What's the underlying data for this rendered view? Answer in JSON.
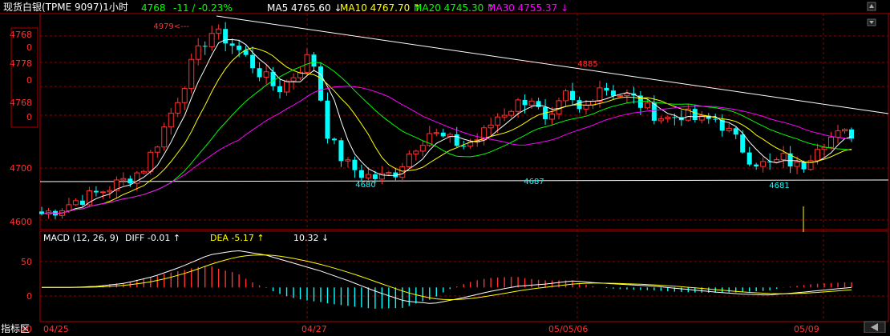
{
  "header": {
    "title": "现货白银(TPME  9097)1小时",
    "last": "4768",
    "change": "-11 / -0.23%",
    "ma": [
      {
        "label": "MA5 4765.60 ↓",
        "color": "#ffffff"
      },
      {
        "label": "MA10 4767.70 ↑",
        "color": "#ffff00"
      },
      {
        "label": "MA20 4745.30 ↑",
        "color": "#00ff00"
      },
      {
        "label": "MA30 4755.37 ↓",
        "color": "#ff00ff"
      }
    ]
  },
  "price_axis_labels": [
    "4768",
    "0",
    "4778",
    "0",
    "4768",
    "0",
    "4700",
    "4600"
  ],
  "macd_header": {
    "name": "MACD (12, 26, 9)",
    "diff": "DIFF  -0.01 ↑",
    "dea": "DEA  -5.17 ↑",
    "macd": "10.32 ↓"
  },
  "macd_axis_labels": [
    "50",
    "0",
    "-50"
  ],
  "date_labels": [
    "04/25",
    "04/27",
    "05/05/06",
    "05/09"
  ],
  "footer": {
    "indicator_tab": "指标区"
  },
  "colors": {
    "up": "#ff3232",
    "down": "#00ffff",
    "ma5": "#ffffff",
    "ma10": "#ffff00",
    "ma20": "#00ff00",
    "ma30": "#ff00ff",
    "grid": "#8b0000",
    "axis": "#b00000",
    "dea": "#ffff00",
    "diff": "#ffffff"
  },
  "chart_data": {
    "type": "candlestick",
    "title": "现货白银(TPME  9097)1小时",
    "ylim": [
      4590,
      4990
    ],
    "macd_ylim": [
      -60,
      80
    ],
    "annotations": [
      {
        "text": "4979",
        "value": 4979
      },
      {
        "text": "4885",
        "value": 4885
      },
      {
        "text": "4680",
        "value": 4680
      },
      {
        "text": "4687",
        "value": 4687
      },
      {
        "text": "4681",
        "value": 4681
      }
    ],
    "price_anchors": [
      4615,
      4625,
      4640,
      4650,
      4665,
      4680,
      4700,
      4760,
      4830,
      4905,
      4960,
      4945,
      4915,
      4880,
      4850,
      4880,
      4920,
      4760,
      4710,
      4690,
      4682,
      4695,
      4740,
      4770,
      4755,
      4745,
      4760,
      4800,
      4820,
      4838,
      4775,
      4840,
      4805,
      4860,
      4845,
      4835,
      4810,
      4795,
      4805,
      4790,
      4795,
      4760,
      4720,
      4705,
      4720,
      4700,
      4750,
      4762,
      4768
    ],
    "macd_anchors": [
      0,
      0,
      2,
      8,
      20,
      38,
      60,
      68,
      60,
      45,
      30,
      12,
      -8,
      -25,
      -30,
      -20,
      -8,
      2,
      6,
      12,
      8,
      5,
      2,
      -3,
      -8,
      -12,
      -14,
      -10,
      -5,
      -0.01
    ]
  },
  "drawn_count": 120
}
